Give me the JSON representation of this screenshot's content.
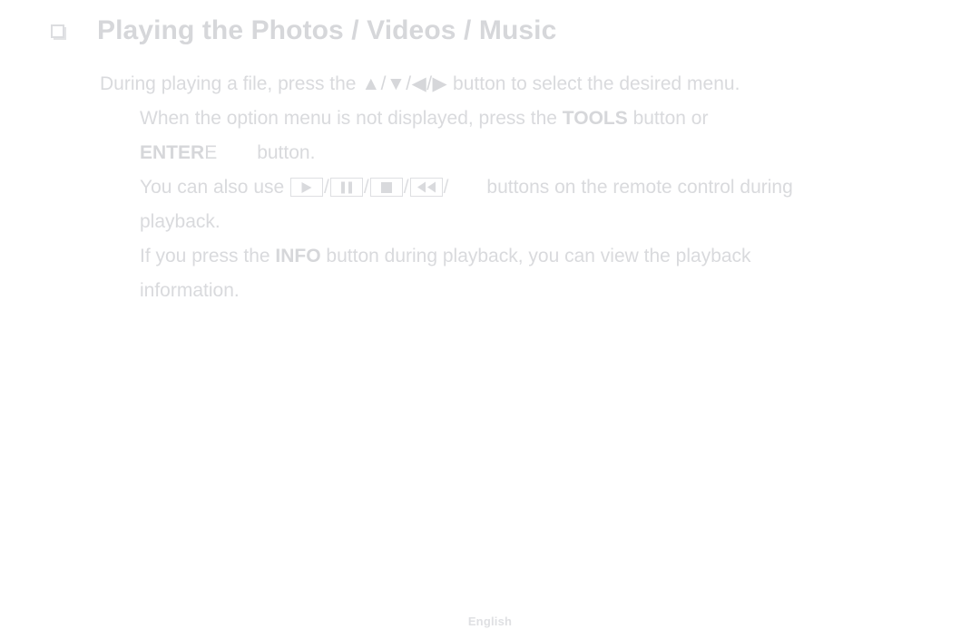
{
  "heading": {
    "bullet_icon": "hollow-square-bullet-icon",
    "title": "Playing the Photos / Videos / Music"
  },
  "body": {
    "paragraph_1": {
      "text_before": "During playing a file, press the ",
      "arrows": "▲/▼/◀/▶",
      "text_after": " button to select the desired menu."
    },
    "paragraph_2": {
      "text_before": "When the option menu is not displayed, press the ",
      "bold_key_1": "TOOLS",
      "text_middle": " button or",
      "bold_key_2": "ENTER",
      "enter_symbol": "E",
      "text_after": "button."
    },
    "paragraph_3": {
      "text_before": "You can also use ",
      "keys": [
        {
          "name": "play-key",
          "glyph": "play-icon"
        },
        {
          "name": "pause-key",
          "glyph": "pause-icon"
        },
        {
          "name": "stop-key",
          "glyph": "stop-icon"
        },
        {
          "name": "rewind-key",
          "glyph": "rewind-icon"
        },
        {
          "name": "fast-forward-key",
          "glyph": "missing-glyph"
        }
      ],
      "separator": "/",
      "text_after": "buttons on the remote control during",
      "text_wrap": "playback."
    },
    "paragraph_4": {
      "text_before": "If you press the ",
      "bold_key": "INFO",
      "text_after": " button during playback, you can view the playback",
      "text_wrap": "information."
    }
  },
  "footer": {
    "language": "English"
  },
  "colors": {
    "text": "#d9dadd",
    "bold_text": "#d6d7da",
    "border": "#dedfe2",
    "background": "#ffffff"
  }
}
